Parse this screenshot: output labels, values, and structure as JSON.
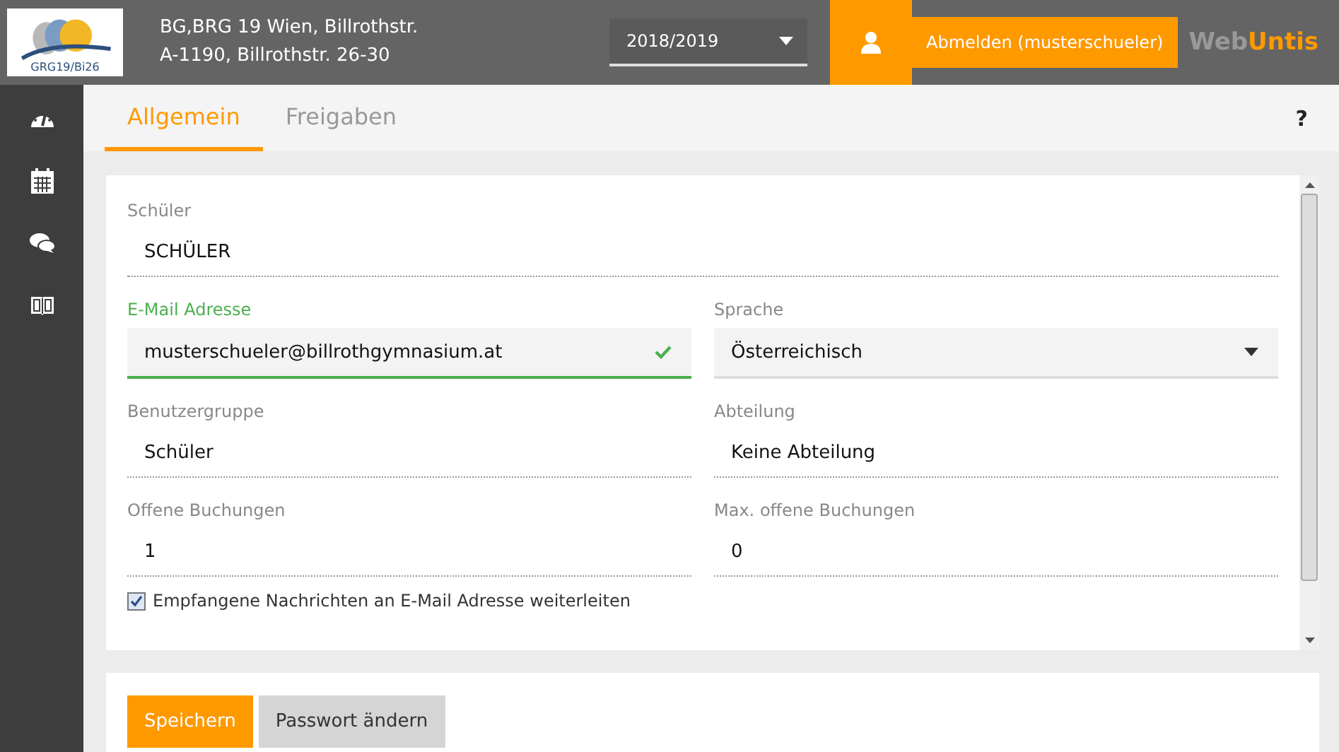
{
  "header": {
    "logo_text": "GRG19/Bi26",
    "school_name": "BG,BRG 19 Wien, Billrothstr.",
    "school_address": "A-1190, Billrothstr. 26-30",
    "year_select": {
      "value": "2018/2019"
    },
    "logout_button": "Abmelden (musterschueler)",
    "brand": {
      "part_1": "Web",
      "part_2": "Untis"
    }
  },
  "sidebar": {
    "items": [
      {
        "kind": "dashboard",
        "selected": false
      },
      {
        "kind": "calendar",
        "selected": false
      },
      {
        "kind": "messages",
        "selected": false
      },
      {
        "kind": "book",
        "selected": false
      }
    ]
  },
  "tabs": [
    {
      "label": "Allgemein",
      "selected": true
    },
    {
      "label": "Freigaben",
      "selected": false
    }
  ],
  "help": "?",
  "form": {
    "fields": [
      {
        "label": "Schüler",
        "value": "SCHÜLER",
        "kind": "text",
        "wide": true,
        "valid": false
      },
      {
        "label": "E-Mail Adresse",
        "value": "musterschueler@billrothgymnasium.at",
        "kind": "input",
        "wide": false,
        "valid": true
      },
      {
        "label": "Sprache",
        "value": "Österreichisch",
        "kind": "select",
        "wide": false,
        "valid": false
      },
      {
        "label": "Benutzergruppe",
        "value": "Schüler",
        "kind": "text",
        "wide": false,
        "valid": false
      },
      {
        "label": "Abteilung",
        "value": "Keine Abteilung",
        "kind": "text",
        "wide": false,
        "valid": false
      },
      {
        "label": "Offene Buchungen",
        "value": "1",
        "kind": "text",
        "wide": false,
        "valid": false
      },
      {
        "label": "Max. offene Buchungen",
        "value": "0",
        "kind": "text",
        "wide": false,
        "valid": false
      }
    ],
    "checkbox": {
      "label": "Empfangene Nachrichten an E-Mail Adresse weiterleiten",
      "checked": true
    }
  },
  "buttons": [
    {
      "label": "Speichern",
      "kind": "primary"
    },
    {
      "label": "Passwort ändern",
      "kind": "secondary"
    }
  ]
}
